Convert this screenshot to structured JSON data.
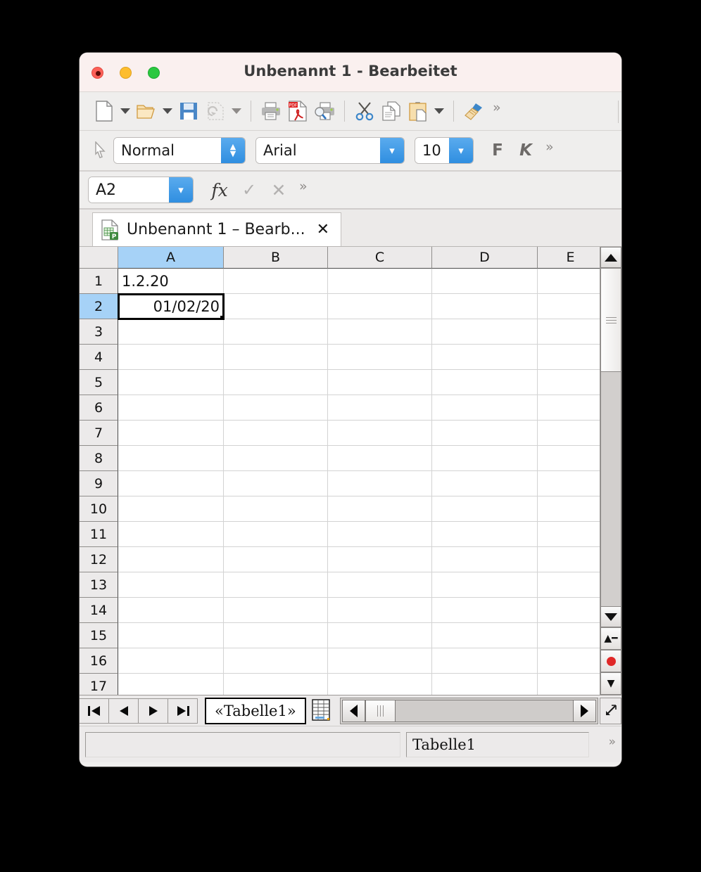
{
  "window": {
    "title": "Unbenannt 1 - Bearbeitet",
    "traffic_lights": [
      "close-red",
      "minimize-yellow",
      "maximize-green"
    ]
  },
  "toolbar": {
    "items": [
      {
        "name": "new-document",
        "icon": "document-icon",
        "has_dropdown": true
      },
      {
        "name": "open-document",
        "icon": "folder-open-icon",
        "has_dropdown": true
      },
      {
        "name": "save-document",
        "icon": "floppy-disk-icon",
        "has_dropdown": false
      },
      {
        "name": "undo",
        "icon": "undo-icon",
        "has_dropdown": true,
        "disabled": true
      },
      {
        "name": "print",
        "icon": "printer-icon",
        "has_dropdown": false
      },
      {
        "name": "export-pdf",
        "icon": "pdf-icon",
        "has_dropdown": false
      },
      {
        "name": "print-preview",
        "icon": "print-preview-icon",
        "has_dropdown": false
      },
      {
        "name": "cut",
        "icon": "scissors-icon",
        "has_dropdown": false
      },
      {
        "name": "copy",
        "icon": "copy-icon",
        "has_dropdown": false
      },
      {
        "name": "paste",
        "icon": "clipboard-icon",
        "has_dropdown": true
      },
      {
        "name": "clone-formatting",
        "icon": "paintbrush-icon",
        "has_dropdown": false
      }
    ],
    "overflow_label": "»"
  },
  "formatbar": {
    "paragraph_style": "Normal",
    "font_name": "Arial",
    "font_size": "10",
    "bold_label": "F",
    "italic_label": "K",
    "overflow_label": "»"
  },
  "formulabar": {
    "name_box_value": "A2",
    "function_wizard_label": "fx",
    "accept_label": "✓",
    "reject_label": "✕",
    "overflow_label": "»",
    "input_line_value": ""
  },
  "doctab": {
    "label": "Unbenannt 1 – Bearb...",
    "close_label": "✕"
  },
  "grid": {
    "columns": [
      "A",
      "B",
      "C",
      "D",
      "E"
    ],
    "selected_column": "A",
    "rows": [
      "1",
      "2",
      "3",
      "4",
      "5",
      "6",
      "7",
      "8",
      "9",
      "10",
      "11",
      "12",
      "13",
      "14",
      "15",
      "16",
      "17"
    ],
    "selected_row": "2",
    "cells": {
      "A1": {
        "value": "1.2.20",
        "align": "left"
      },
      "A2": {
        "value": "01/02/20",
        "align": "right",
        "selected": true
      }
    }
  },
  "sheetnav": {
    "first_label": "❘◀",
    "prev_label": "◀",
    "next_label": "▶",
    "last_label": "▶❘",
    "sheet_tab_label": "«Tabelle1»",
    "add_sheet_name": "add-sheet-icon"
  },
  "statusbar": {
    "left_field": "",
    "sheet_field": "Tabelle1",
    "overflow_label": "»"
  },
  "colors": {
    "accent_blue": "#2f8ee0",
    "selection_blue": "#a6d2f7",
    "window_bg": "#f0efee",
    "titlebar_bg": "#faf0ef",
    "desktop_bg": "#000000"
  }
}
